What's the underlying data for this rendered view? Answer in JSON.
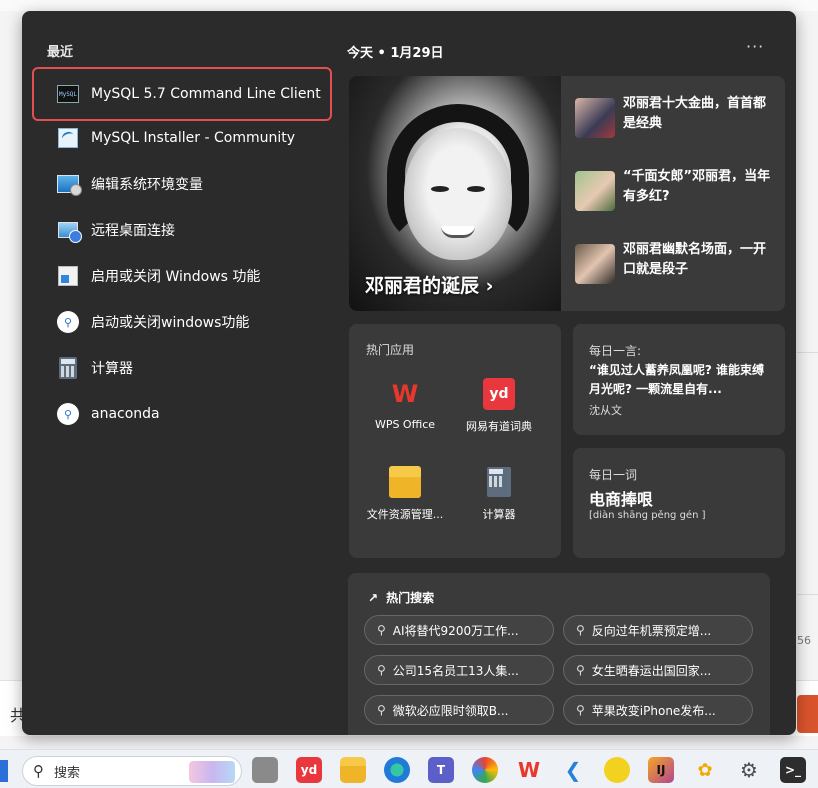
{
  "background": {
    "left_partial_char": "共",
    "right_partial_num": "56"
  },
  "recent": {
    "title": "最近",
    "items": [
      {
        "label": "MySQL 5.7 Command Line Client",
        "icon": "mysql-console-icon",
        "highlighted": true
      },
      {
        "label": "MySQL Installer - Community",
        "icon": "mysql-installer-icon"
      },
      {
        "label": "编辑系统环境变量",
        "icon": "system-properties-icon"
      },
      {
        "label": "远程桌面连接",
        "icon": "remote-desktop-icon"
      },
      {
        "label": "启用或关闭 Windows 功能",
        "icon": "windows-features-icon"
      },
      {
        "label": "启动或关闭windows功能",
        "icon": "search-icon"
      },
      {
        "label": "计算器",
        "icon": "calculator-icon"
      },
      {
        "label": "anaconda",
        "icon": "search-icon"
      }
    ]
  },
  "widgets": {
    "date": "今天 • 1月29日",
    "more": "···",
    "news": {
      "caption": "邓丽君的诞辰 ›",
      "items": [
        {
          "title": "邓丽君十大金曲，首首都是经典"
        },
        {
          "title": "“千面女郎”邓丽君，当年有多红?"
        },
        {
          "title": "邓丽君幽默名场面，一开口就是段子"
        }
      ]
    },
    "hot_apps": {
      "title": "热门应用",
      "apps": [
        {
          "label": "WPS Office",
          "icon": "wps-icon"
        },
        {
          "label": "网易有道词典",
          "icon": "youdao-icon"
        },
        {
          "label": "文件资源管理...",
          "icon": "folder-icon"
        },
        {
          "label": "计算器",
          "icon": "calculator-icon"
        }
      ]
    },
    "daily_quote": {
      "kicker": "每日一言:",
      "text": "“谁见过人蓄养凤凰呢? 谁能束缚月光呢? 一颗流星自有...",
      "author": "沈从文"
    },
    "daily_word": {
      "kicker": "每日一词",
      "word": "电商捧哏",
      "pinyin": "[diàn shāng pěng gén ]"
    },
    "hot_search": {
      "title": "热门搜索",
      "items": [
        "AI将替代9200万工作...",
        "反向过年机票预定增...",
        "公司15名员工13人集...",
        "女生晒春运出国回家...",
        "微软必应限时领取B...",
        "苹果改变iPhone发布..."
      ]
    }
  },
  "taskbar": {
    "search_placeholder": "搜索"
  },
  "colors": {
    "panel_bg": "#2b2b2b",
    "card_bg": "#3a3a3a",
    "highlight_border": "#e05050"
  }
}
